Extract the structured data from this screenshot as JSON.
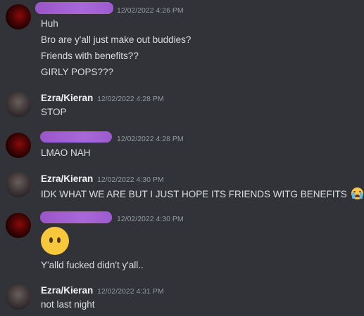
{
  "messages": [
    {
      "author": "",
      "author_redacted": true,
      "avatar_icon": "red-avatar",
      "timestamp": "12/02/2022 4:26 PM",
      "lines": [
        "Huh",
        "Bro are y'all just make out buddies?",
        "Friends with benefits??",
        "GIRLY POPS???"
      ]
    },
    {
      "author": "Ezra/Kieran",
      "avatar_icon": "ezra-avatar",
      "timestamp": "12/02/2022 4:28 PM",
      "lines": [
        "STOP"
      ]
    },
    {
      "author": "",
      "author_redacted": true,
      "avatar_icon": "red-avatar",
      "timestamp": "12/02/2022 4:28 PM",
      "lines": [
        "LMAO NAH"
      ]
    },
    {
      "author": "Ezra/Kieran",
      "avatar_icon": "ezra-avatar",
      "timestamp": "12/02/2022 4:30 PM",
      "lines": [
        "IDK WHAT WE ARE BUT I JUST HOPE ITS FRIENDS WITG BENEFITS"
      ],
      "trailing_emoji": "loudly-crying-face-emoji"
    },
    {
      "author": "",
      "author_redacted": true,
      "avatar_icon": "red-avatar",
      "timestamp": "12/02/2022 4:30 PM",
      "emoji": "face-without-mouth-emoji",
      "lines": [
        "Y'alld fucked didn't y'all.."
      ]
    },
    {
      "author": "Ezra/Kieran",
      "avatar_icon": "ezra-avatar",
      "timestamp": "12/02/2022 4:31 PM",
      "lines": [
        "not last night"
      ]
    }
  ],
  "colors": {
    "background": "#313338",
    "redaction": "#a062d4",
    "timestamp": "#949ba4",
    "text": "#dbdee1"
  }
}
